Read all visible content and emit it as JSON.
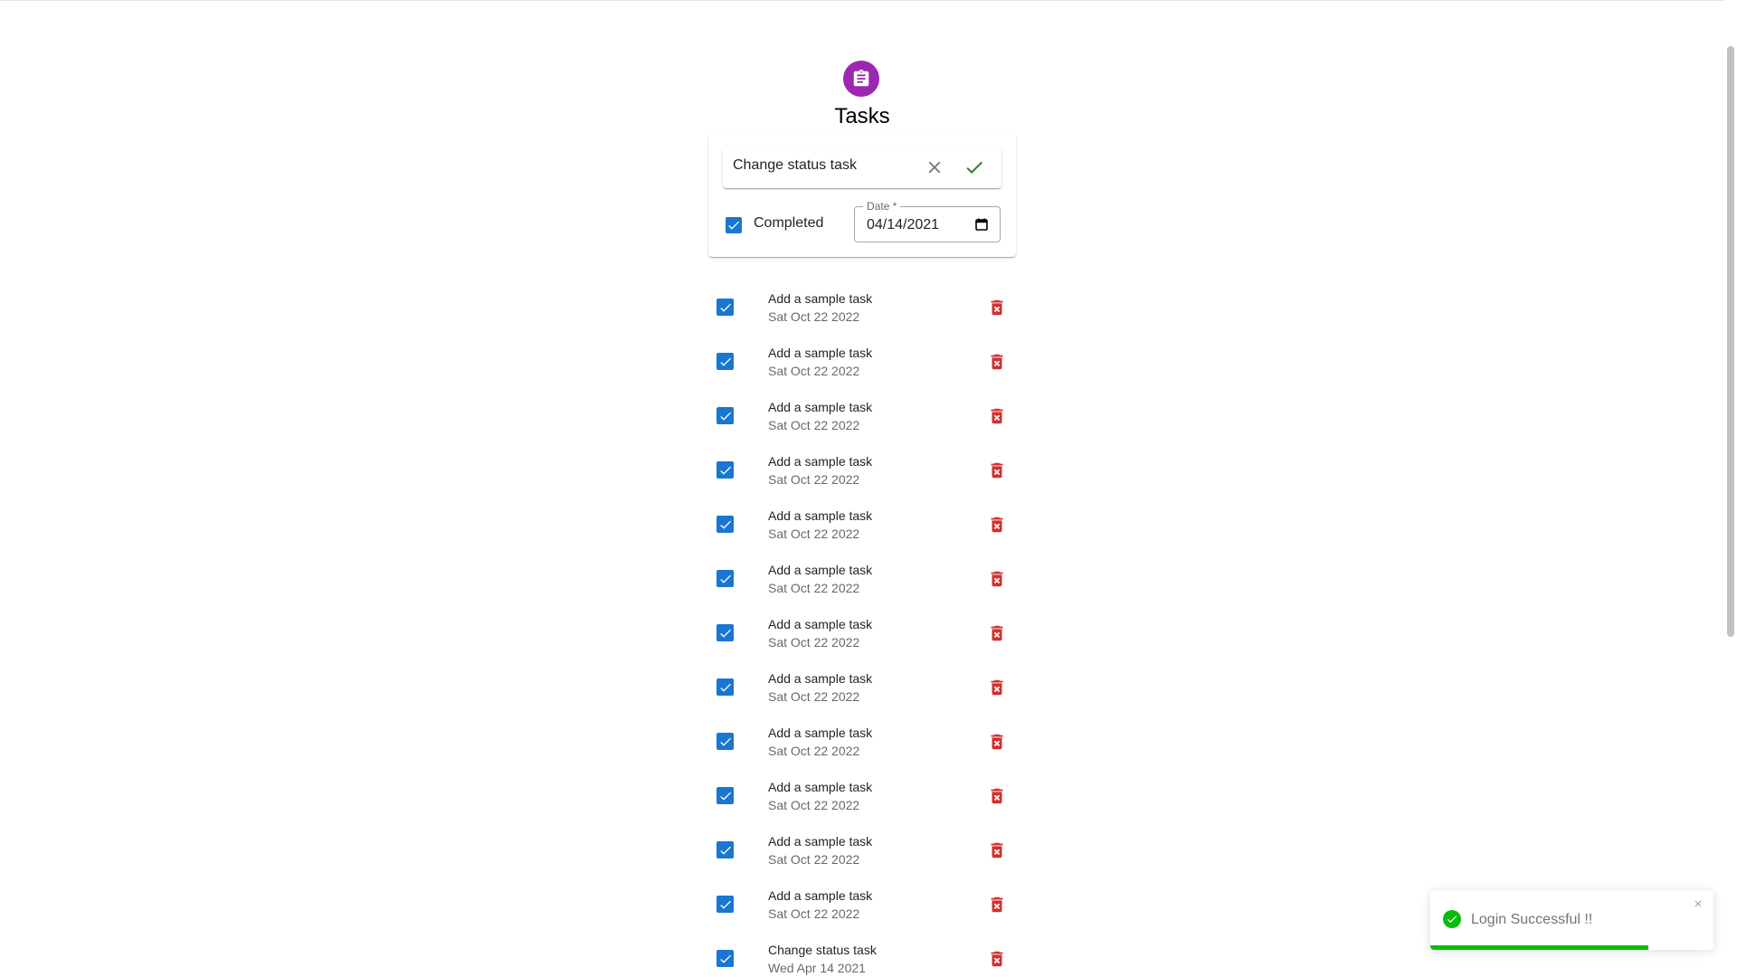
{
  "header": {
    "title": "Tasks",
    "logo_icon": "clipboard-icon",
    "logo_color": "#9c27b0"
  },
  "edit_card": {
    "task_input_value": "Change status task",
    "completed_label": "Completed",
    "completed_checked": true,
    "date_label": "Date *",
    "date_value": "04/14/2021"
  },
  "tasks": [
    {
      "name": "Add a sample task",
      "date": "Sat Oct 22 2022",
      "checked": true
    },
    {
      "name": "Add a sample task",
      "date": "Sat Oct 22 2022",
      "checked": true
    },
    {
      "name": "Add a sample task",
      "date": "Sat Oct 22 2022",
      "checked": true
    },
    {
      "name": "Add a sample task",
      "date": "Sat Oct 22 2022",
      "checked": true
    },
    {
      "name": "Add a sample task",
      "date": "Sat Oct 22 2022",
      "checked": true
    },
    {
      "name": "Add a sample task",
      "date": "Sat Oct 22 2022",
      "checked": true
    },
    {
      "name": "Add a sample task",
      "date": "Sat Oct 22 2022",
      "checked": true
    },
    {
      "name": "Add a sample task",
      "date": "Sat Oct 22 2022",
      "checked": true
    },
    {
      "name": "Add a sample task",
      "date": "Sat Oct 22 2022",
      "checked": true
    },
    {
      "name": "Add a sample task",
      "date": "Sat Oct 22 2022",
      "checked": true
    },
    {
      "name": "Add a sample task",
      "date": "Sat Oct 22 2022",
      "checked": true
    },
    {
      "name": "Add a sample task",
      "date": "Sat Oct 22 2022",
      "checked": true
    },
    {
      "name": "Change status task",
      "date": "Wed Apr 14 2021",
      "checked": true
    }
  ],
  "toast": {
    "message": "Login Successful !!",
    "progress": 0.77
  },
  "colors": {
    "accent": "#1976d2",
    "delete": "#d32f2f",
    "success": "#07bc0c",
    "confirm": "#2e7d32"
  }
}
